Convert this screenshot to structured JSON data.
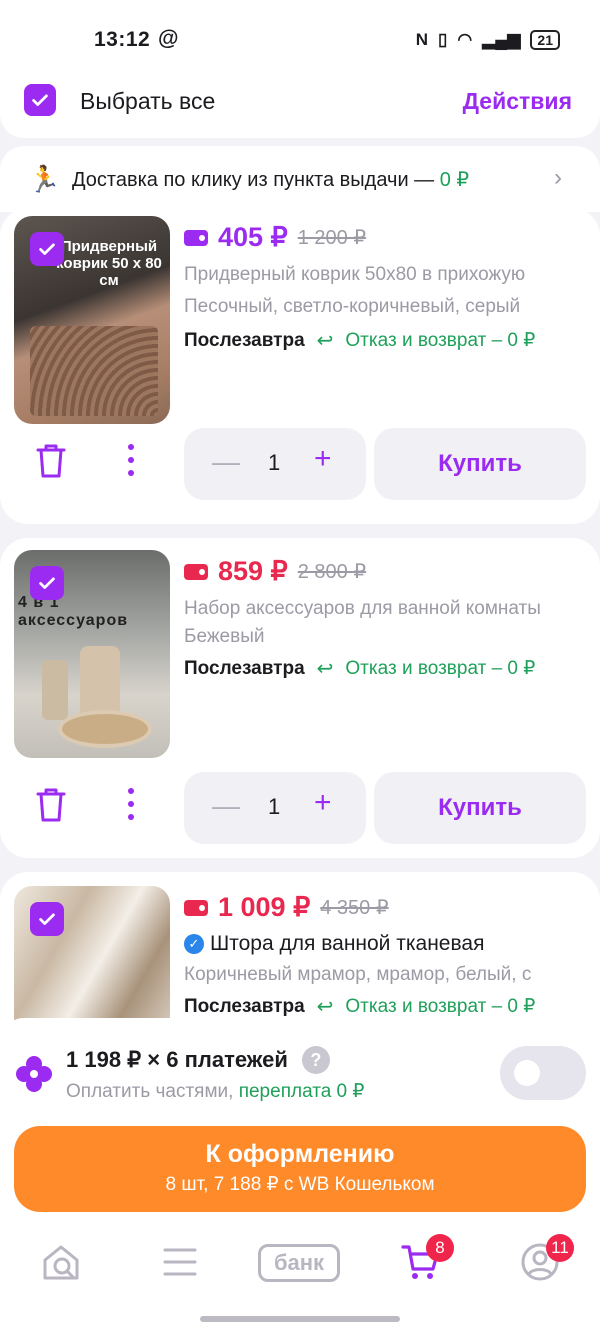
{
  "status_bar": {
    "time": "13:12",
    "at_symbol": "@",
    "battery": "21"
  },
  "header": {
    "select_all": "Выбрать все",
    "actions": "Действия"
  },
  "delivery_banner": {
    "text": "Доставка по клику из пункта выдачи — ",
    "price": "0 ₽"
  },
  "items": [
    {
      "price": "405 ₽",
      "old_price": "1 200 ₽",
      "price_color": "#9b2bf0",
      "name": "Придверный коврик 50х80 в прихожую",
      "variant": "Песочный, светло-коричневый, серый",
      "delivery": "Послезавтра",
      "return": "Отказ и возврат – 0 ₽",
      "qty": "1",
      "buy": "Купить",
      "thumb_label": "Придверный коврик 50 x 80 см"
    },
    {
      "price": "859 ₽",
      "old_price": "2 800 ₽",
      "price_color": "#e8284e",
      "name": "Набор аксессуаров для ванной комнаты",
      "variant": "Бежевый",
      "delivery": "Послезавтра",
      "return": "Отказ и возврат – 0 ₽",
      "qty": "1",
      "buy": "Купить",
      "thumb_label": "4 в 1 аксессуаров"
    },
    {
      "price": "1 009 ₽",
      "old_price": "4 350 ₽",
      "price_color": "#e8284e",
      "name": "Штора для ванной тканевая",
      "variant": "Коричневый мрамор, мрамор, белый, с",
      "delivery": "Послезавтра",
      "return": "Отказ и возврат – 0 ₽"
    }
  ],
  "split_payment": {
    "amount": "1 198 ₽ × 6 платежей",
    "subtitle": "Оплатить частями, ",
    "overpay": "переплата 0 ₽"
  },
  "checkout": {
    "title": "К оформлению",
    "subtitle": "8 шт, 7 188 ₽ с WB Кошельком"
  },
  "tabbar": {
    "bank": "банк",
    "cart_badge": "8",
    "profile_badge": "11"
  },
  "colors": {
    "accent": "#9b2bf0",
    "checkout": "#ff8a2a",
    "green": "#1fa05a",
    "badge": "#f0254b"
  }
}
